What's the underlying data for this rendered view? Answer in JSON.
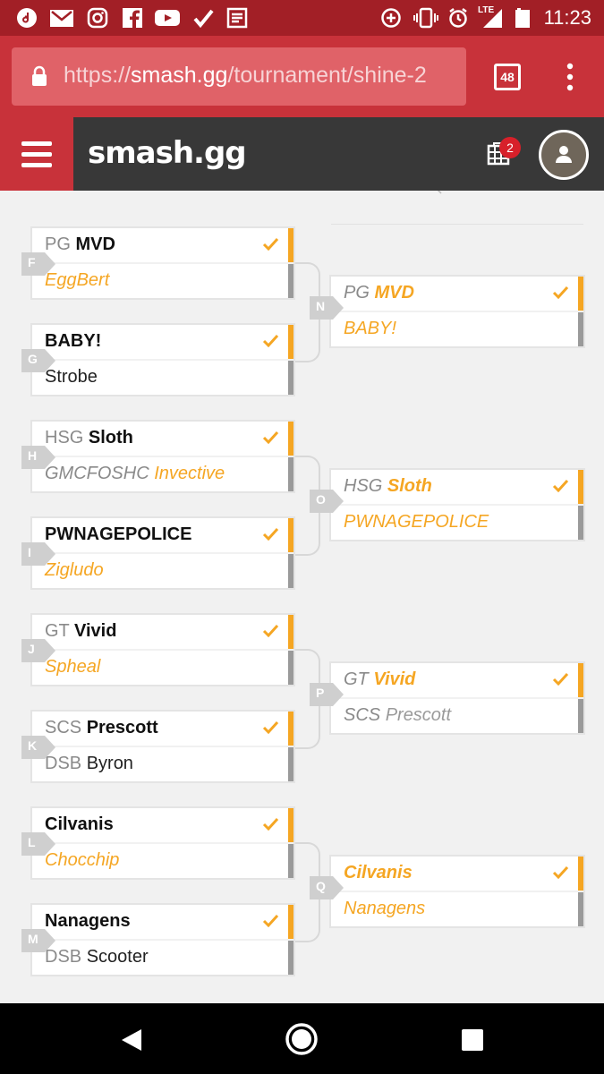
{
  "status_bar": {
    "time": "11:23",
    "network": "LTE",
    "icons": [
      "tiktok-icon",
      "gmail-icon",
      "instagram-icon",
      "facebook-icon",
      "youtube-icon",
      "feedly-icon",
      "news-icon",
      "data-saver-icon",
      "vibrate-icon",
      "alarm-icon",
      "signal-icon",
      "battery-icon"
    ]
  },
  "browser": {
    "url_prefix": "https://",
    "url_host": "smash.gg",
    "url_path": "/tournament/shine-2",
    "tab_count": "48"
  },
  "header": {
    "logo": "smash.gg",
    "cart_count": "2"
  },
  "round1": [
    {
      "tag": "F",
      "top": {
        "prefix": "PG",
        "name": "MVD"
      },
      "bottom": {
        "prefix": "",
        "name": "EggBert"
      }
    },
    {
      "tag": "G",
      "top": {
        "prefix": "",
        "name": "BABY!"
      },
      "bottom": {
        "prefix": "",
        "name": "Strobe"
      }
    },
    {
      "tag": "H",
      "top": {
        "prefix": "HSG",
        "name": "Sloth"
      },
      "bottom": {
        "prefix": "GMCFOSHC",
        "name": "Invective"
      }
    },
    {
      "tag": "I",
      "top": {
        "prefix": "",
        "name": "PWNAGEPOLICE"
      },
      "bottom": {
        "prefix": "",
        "name": "Zigludo"
      }
    },
    {
      "tag": "J",
      "top": {
        "prefix": "GT",
        "name": "Vivid"
      },
      "bottom": {
        "prefix": "",
        "name": "Spheal"
      }
    },
    {
      "tag": "K",
      "top": {
        "prefix": "SCS",
        "name": "Prescott"
      },
      "bottom": {
        "prefix": "DSB",
        "name": "Byron"
      }
    },
    {
      "tag": "L",
      "top": {
        "prefix": "",
        "name": "Cilvanis"
      },
      "bottom": {
        "prefix": "",
        "name": "Chocchip"
      }
    },
    {
      "tag": "M",
      "top": {
        "prefix": "",
        "name": "Nanagens"
      },
      "bottom": {
        "prefix": "DSB",
        "name": "Scooter"
      }
    }
  ],
  "round2": [
    {
      "tag": "N",
      "top": {
        "prefix": "PG",
        "name": "MVD"
      },
      "bottom": {
        "prefix": "",
        "name": "BABY!"
      }
    },
    {
      "tag": "O",
      "top": {
        "prefix": "HSG",
        "name": "Sloth"
      },
      "bottom": {
        "prefix": "",
        "name": "PWNAGEPOLICE"
      }
    },
    {
      "tag": "P",
      "top": {
        "prefix": "GT",
        "name": "Vivid"
      },
      "bottom": {
        "prefix": "SCS",
        "name": "Prescott"
      }
    },
    {
      "tag": "Q",
      "top": {
        "prefix": "",
        "name": "Cilvanis"
      },
      "bottom": {
        "prefix": "",
        "name": "Nanagens"
      }
    }
  ],
  "colors": {
    "status_bar": "#a21f26",
    "browser_bar": "#c8323a",
    "header": "#383838",
    "accent_orange": "#f5a623",
    "loser_stripe": "#9a9a9a"
  }
}
